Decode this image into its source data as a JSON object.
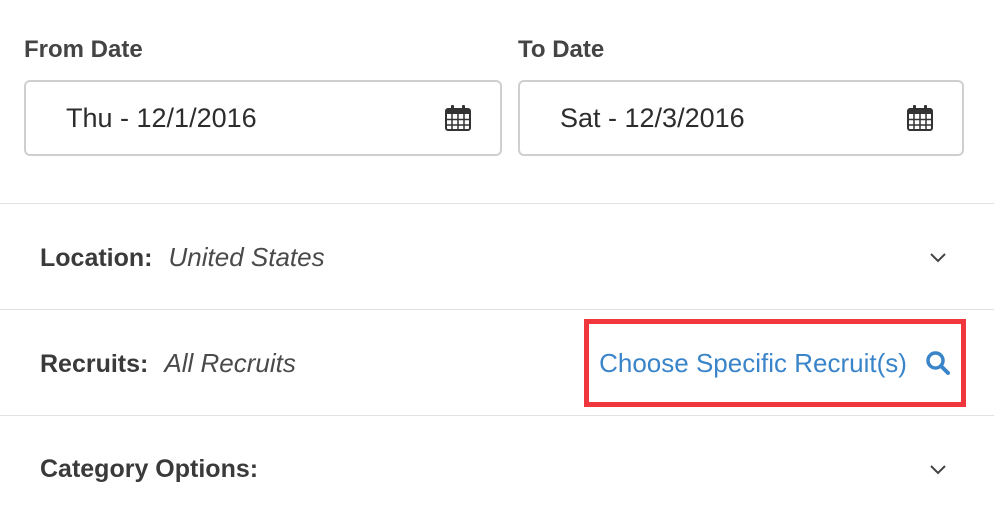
{
  "from_date": {
    "label": "From Date",
    "value": "Thu - 12/1/2016",
    "icon": "calendar-icon"
  },
  "to_date": {
    "label": "To Date",
    "value": "Sat - 12/3/2016",
    "icon": "calendar-icon"
  },
  "location": {
    "label": "Location:",
    "value": "United States",
    "icon": "chevron-down-icon"
  },
  "recruits": {
    "label": "Recruits:",
    "value": "All Recruits",
    "choose_link": "Choose Specific Recruit(s)",
    "choose_icon": "search-icon",
    "highlight_color": "#f0373d",
    "link_color": "#3a84c9"
  },
  "category": {
    "label": "Category Options:",
    "icon": "chevron-down-icon"
  }
}
